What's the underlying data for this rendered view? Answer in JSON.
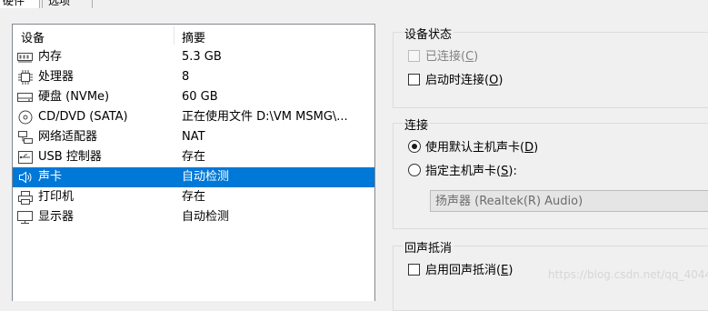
{
  "tabs": [
    {
      "label": "硬件"
    },
    {
      "label": "选项"
    }
  ],
  "device_list": {
    "col_device": "设备",
    "col_summary": "摘要",
    "items": [
      {
        "icon": "memory-icon",
        "name": "内存",
        "summary": "5.3 GB"
      },
      {
        "icon": "processor-icon",
        "name": "处理器",
        "summary": "8"
      },
      {
        "icon": "hard-disk-icon",
        "name": "硬盘 (NVMe)",
        "summary": "60 GB"
      },
      {
        "icon": "cd-dvd-icon",
        "name": "CD/DVD (SATA)",
        "summary": "正在使用文件 D:\\VM MSMG\\..."
      },
      {
        "icon": "network-adapter-icon",
        "name": "网络适配器",
        "summary": "NAT"
      },
      {
        "icon": "usb-icon",
        "name": "USB 控制器",
        "summary": "存在"
      },
      {
        "icon": "speaker-icon",
        "name": "声卡",
        "summary": "自动检测",
        "selected": true
      },
      {
        "icon": "printer-icon",
        "name": "打印机",
        "summary": "存在"
      },
      {
        "icon": "monitor-icon",
        "name": "显示器",
        "summary": "自动检测"
      }
    ]
  },
  "device_status": {
    "title": "设备状态",
    "connected": {
      "label": "已连接",
      "key": "C",
      "checked": false,
      "disabled": true
    },
    "connect_on_startup": {
      "label": "启动时连接",
      "key": "O",
      "checked": false
    }
  },
  "connection": {
    "title": "连接",
    "use_default": {
      "label": "使用默认主机声卡",
      "key": "D",
      "selected": true
    },
    "specify": {
      "label": "指定主机声卡",
      "key": "S",
      "suffix": ":"
    },
    "host_sound_card": "扬声器 (Realtek(R) Audio)"
  },
  "echo_cancellation": {
    "title": "回声抵消",
    "enable": {
      "label": "启用回声抵消",
      "key": "E",
      "checked": false
    }
  },
  "watermark": "https://blog.csdn.net/qq_40448816"
}
